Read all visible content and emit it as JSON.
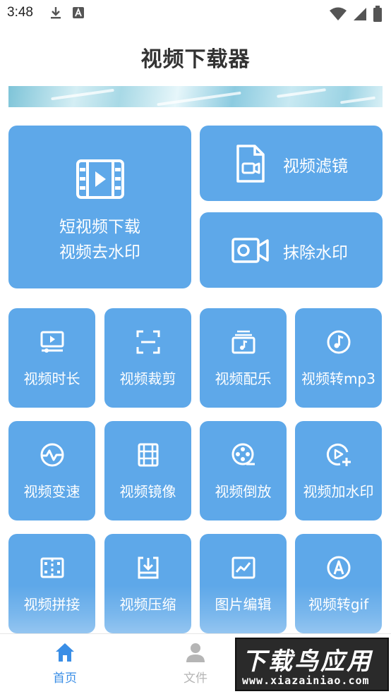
{
  "status_bar": {
    "time": "3:48"
  },
  "header": {
    "title": "视频下载器"
  },
  "main_features": {
    "short_video": {
      "line1": "短视频下载",
      "line2": "视频去水印"
    },
    "video_filter": {
      "label": "视频滤镜"
    },
    "remove_watermark": {
      "label": "抹除水印"
    }
  },
  "tools": [
    {
      "label": "视频时长",
      "icon": "monitor-play-icon"
    },
    {
      "label": "视频裁剪",
      "icon": "crop-frame-icon"
    },
    {
      "label": "视频配乐",
      "icon": "music-box-icon"
    },
    {
      "label": "视频转mp3",
      "icon": "music-note-icon"
    },
    {
      "label": "视频变速",
      "icon": "speed-wave-icon"
    },
    {
      "label": "视频镜像",
      "icon": "film-strip-icon"
    },
    {
      "label": "视频倒放",
      "icon": "film-reel-icon"
    },
    {
      "label": "视频加水印",
      "icon": "play-add-icon"
    },
    {
      "label": "视频拼接",
      "icon": "splice-icon"
    },
    {
      "label": "视频压缩",
      "icon": "compress-tray-icon"
    },
    {
      "label": "图片编辑",
      "icon": "image-chart-icon"
    },
    {
      "label": "视频转gif",
      "icon": "gif-circle-icon"
    }
  ],
  "bottom_nav": {
    "home": {
      "label": "首页",
      "icon": "home-icon",
      "active": true
    },
    "file": {
      "label": "文件",
      "icon": "user-icon",
      "active": false
    }
  },
  "watermark": {
    "text": "下载鸟应用",
    "url": "www.xiazainiao.com"
  },
  "colors": {
    "card": "#5ea8e9",
    "accent": "#3a8ee6",
    "inactive": "#b5b5b5"
  }
}
